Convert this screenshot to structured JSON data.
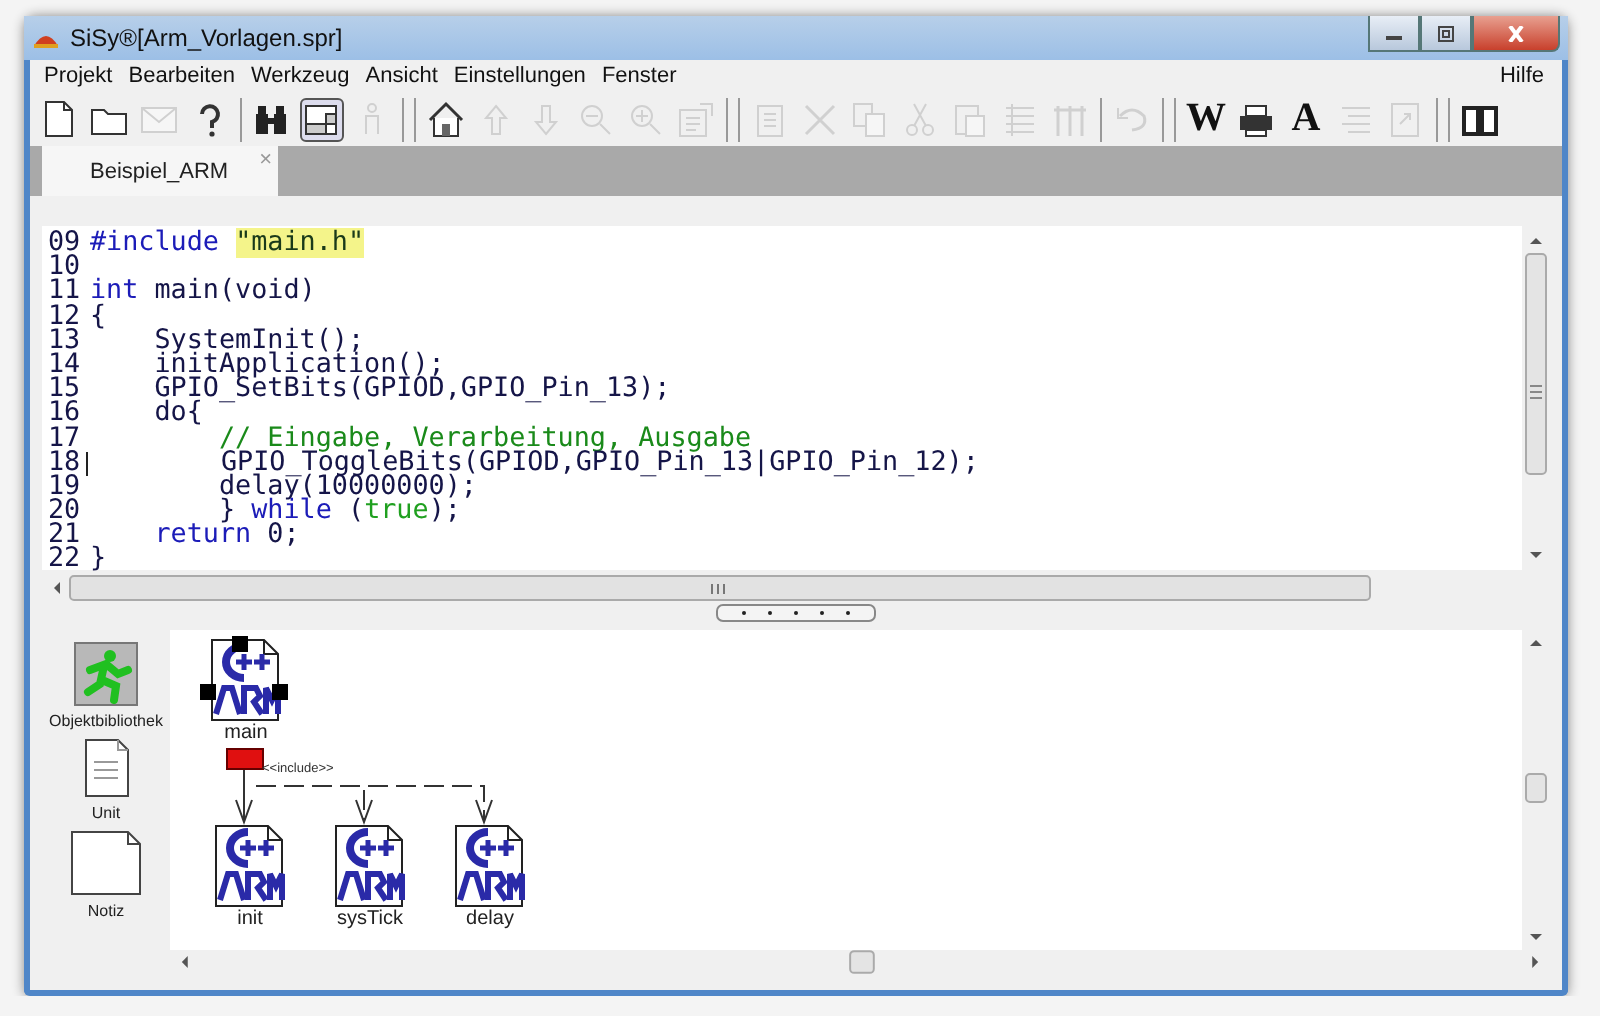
{
  "window": {
    "title": "SiSy®[Arm_Vorlagen.spr]"
  },
  "menu": {
    "left": [
      "Projekt",
      "Bearbeiten",
      "Werkzeug",
      "Ansicht",
      "Einstellungen",
      "Fenster"
    ],
    "right": [
      "Hilfe"
    ]
  },
  "toolbar": [
    {
      "kind": "new",
      "disabled": false,
      "selected": false
    },
    {
      "kind": "open",
      "disabled": false,
      "selected": false
    },
    {
      "kind": "mail",
      "disabled": true,
      "selected": false
    },
    {
      "kind": "help",
      "disabled": false,
      "selected": false
    },
    {
      "kind": "separator"
    },
    {
      "kind": "find",
      "disabled": false,
      "selected": false
    },
    {
      "kind": "window",
      "disabled": false,
      "selected": true
    },
    {
      "kind": "person",
      "disabled": true,
      "selected": false
    },
    {
      "kind": "separator"
    },
    {
      "kind": "separator"
    },
    {
      "kind": "home",
      "disabled": false,
      "selected": false
    },
    {
      "kind": "up",
      "disabled": true,
      "selected": false
    },
    {
      "kind": "down",
      "disabled": true,
      "selected": false
    },
    {
      "kind": "zoomout",
      "disabled": true,
      "selected": false
    },
    {
      "kind": "zoomin",
      "disabled": true,
      "selected": false
    },
    {
      "kind": "props",
      "disabled": true,
      "selected": false
    },
    {
      "kind": "separator"
    },
    {
      "kind": "separator"
    },
    {
      "kind": "doc",
      "disabled": true,
      "selected": false
    },
    {
      "kind": "delete",
      "disabled": true,
      "selected": false
    },
    {
      "kind": "copy",
      "disabled": true,
      "selected": false
    },
    {
      "kind": "cut",
      "disabled": true,
      "selected": false
    },
    {
      "kind": "paste",
      "disabled": true,
      "selected": false
    },
    {
      "kind": "list",
      "disabled": true,
      "selected": false
    },
    {
      "kind": "columns",
      "disabled": true,
      "selected": false
    },
    {
      "kind": "separator"
    },
    {
      "kind": "undo",
      "disabled": true,
      "selected": false
    },
    {
      "kind": "separator"
    },
    {
      "kind": "separator"
    },
    {
      "kind": "text",
      "label": "W",
      "disabled": false,
      "selected": false
    },
    {
      "kind": "print",
      "disabled": false,
      "selected": false
    },
    {
      "kind": "text",
      "label": "A",
      "disabled": false,
      "selected": false
    },
    {
      "kind": "lines",
      "disabled": true,
      "selected": false
    },
    {
      "kind": "export",
      "disabled": true,
      "selected": false
    },
    {
      "kind": "separator"
    },
    {
      "kind": "separator"
    },
    {
      "kind": "book",
      "disabled": false,
      "selected": false
    }
  ],
  "tabs": [
    {
      "label": "Beispiel_ARM",
      "close": "×",
      "selected": true
    }
  ],
  "editor": {
    "lines": [
      {
        "number": "09",
        "caret": false,
        "segments": [
          {
            "kind": "keyword",
            "text": "#include "
          },
          {
            "kind": "string",
            "text": "\"main.h\""
          }
        ]
      },
      {
        "number": "10",
        "caret": false
      },
      {
        "number": "11",
        "caret": false,
        "segments": [
          {
            "kind": "keyword",
            "text": "int"
          },
          {
            "kind": "plain",
            "text": " main(void)"
          }
        ]
      },
      {
        "number": "12",
        "caret": false,
        "segments": [
          {
            "kind": "plain",
            "text": "{"
          }
        ]
      },
      {
        "number": "13",
        "caret": false,
        "segments": [
          {
            "kind": "plain",
            "text": "    SystemInit();"
          }
        ]
      },
      {
        "number": "14",
        "caret": false,
        "segments": [
          {
            "kind": "plain",
            "text": "    initApplication();"
          }
        ]
      },
      {
        "number": "15",
        "caret": false,
        "segments": [
          {
            "kind": "plain",
            "text": "    GPIO_SetBits(GPIOD,GPIO_Pin_13);"
          }
        ]
      },
      {
        "number": "16",
        "caret": false,
        "segments": [
          {
            "kind": "plain",
            "text": "    do{"
          }
        ]
      },
      {
        "number": "17",
        "caret": false,
        "segments": [
          {
            "kind": "comment",
            "text": "        // Eingabe, Verarbeitung, Ausgabe"
          }
        ]
      },
      {
        "number": "18",
        "caret": true,
        "segments": [
          {
            "kind": "plain",
            "text": "        GPIO_ToggleBits(GPIOD,GPIO_Pin_13|GPIO_Pin_12);"
          }
        ]
      },
      {
        "number": "19",
        "caret": false,
        "segments": [
          {
            "kind": "plain",
            "text": "        delay(10000000);"
          }
        ]
      },
      {
        "number": "20",
        "caret": false,
        "segments": [
          {
            "kind": "plain",
            "text": "        } "
          },
          {
            "kind": "keyword",
            "text": "while"
          },
          {
            "kind": "plain",
            "text": " ("
          },
          {
            "kind": "literal",
            "text": "true"
          },
          {
            "kind": "plain",
            "text": ");"
          }
        ]
      },
      {
        "number": "21",
        "caret": false,
        "segments": [
          {
            "kind": "keyword",
            "text": "    return"
          },
          {
            "kind": "plain",
            "text": " 0;"
          }
        ]
      },
      {
        "number": "22",
        "caret": false,
        "segments": [
          {
            "kind": "plain",
            "text": "}"
          }
        ]
      }
    ]
  },
  "palette": [
    {
      "kind": "library",
      "label": "Objektbibliothek"
    },
    {
      "kind": "unit",
      "label": "Unit"
    },
    {
      "kind": "note",
      "label": "Notiz"
    }
  ],
  "diagram": {
    "nodes": [
      {
        "label": "main",
        "selected": true,
        "included": false
      },
      {
        "label": "init",
        "selected": false,
        "included": true
      },
      {
        "label": "sysTick",
        "selected": false,
        "included": true
      },
      {
        "label": "delay",
        "selected": false,
        "included": true
      }
    ],
    "connector_label": "<<include>>"
  }
}
